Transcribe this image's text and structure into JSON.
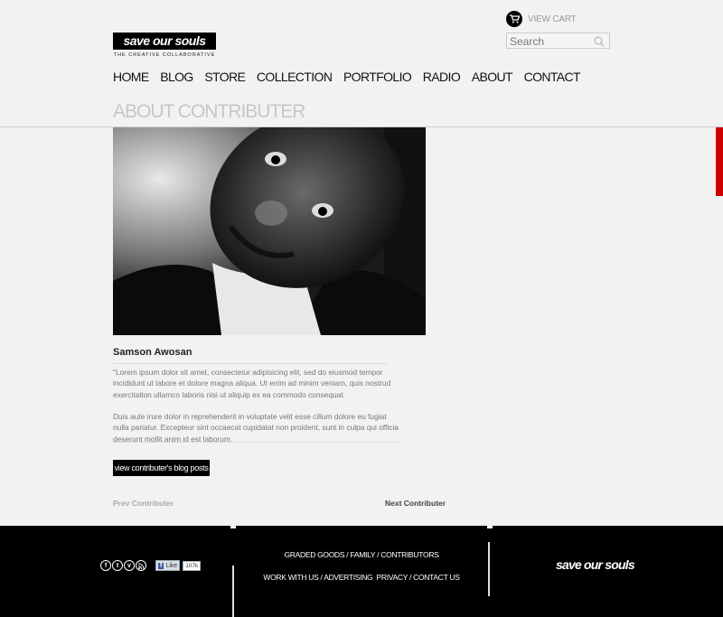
{
  "header": {
    "logo": "save our souls",
    "tagline": "THE CREATIVE COLLABORATIVE",
    "cart_label": "VIEW CART",
    "search_placeholder": "Search"
  },
  "nav": [
    "HOME",
    "BLOG",
    "STORE",
    "COLLECTION",
    "PORTFOLIO",
    "RADIO",
    "ABOUT",
    "CONTACT"
  ],
  "page_title": "ABOUT CONTRIBUTER",
  "contributor": {
    "name": "Samson Awosan",
    "bio": [
      "\"Lorem ipsum dolor sit amet, consectetur adipisicing elit, sed do eiusmod tempor incididunt ut labore et dolore magna aliqua. Ut enim ad minim veniam, quis nostrud exercitation ullamco laboris nisi ut aliquip ex ea commodo consequat.",
      "Duis aute irure dolor in reprehenderit in voluptate velit esse cillum dolore eu fugiat nulla pariatur. Excepteur sint occaecat cupidatat non proident, sunt in culpa qui officia deserunt mollit anim id est laborum."
    ],
    "blog_button": "view contributer's blog posts",
    "prev_label": "Prev Contributer",
    "next_label": "Next Contributer"
  },
  "footer": {
    "social_icons": [
      "facebook-icon",
      "twitter-icon",
      "vimeo-icon",
      "rss-icon"
    ],
    "fb_like": "Like",
    "fb_count": "107k",
    "links_row1": [
      "GRADED GOODS",
      "FAMILY",
      "CONTRIBUTORS"
    ],
    "links_row2": [
      "WORK WITH US",
      "ADVERTISING",
      "PRIVACY",
      "CONTACT US"
    ],
    "logo": "save our souls"
  },
  "colors": {
    "accent_red": "#cc0000",
    "footer_bg": "#000000",
    "page_bg": "#f2f2f2"
  }
}
